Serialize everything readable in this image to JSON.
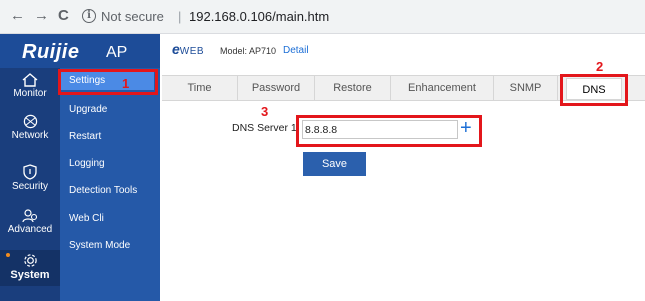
{
  "browser": {
    "back_glyph": "←",
    "forward_glyph": "→",
    "reload_glyph": "C",
    "info_glyph": "i",
    "secure_text": "Not secure",
    "separator": "|",
    "url": "192.168.0.106/main.htm"
  },
  "brand": {
    "logo": "Ruijie",
    "product": "AP"
  },
  "header": {
    "eweb_e": "e",
    "eweb_text": "WEB",
    "model": "Model: AP710",
    "detail_link": "Detail"
  },
  "sidebar": {
    "categories": [
      {
        "label": "Monitor",
        "icon": "home-icon"
      },
      {
        "label": "Network",
        "icon": "globe-icon"
      },
      {
        "label": "Security",
        "icon": "shield-icon"
      },
      {
        "label": "Advanced",
        "icon": "users-icon"
      },
      {
        "label": "System",
        "icon": "gear-icon",
        "selected": true
      }
    ],
    "subitems": [
      {
        "label": "Settings",
        "selected": true
      },
      {
        "label": "Upgrade"
      },
      {
        "label": "Restart"
      },
      {
        "label": "Logging"
      },
      {
        "label": "Detection Tools"
      },
      {
        "label": "Web Cli"
      },
      {
        "label": "System Mode"
      }
    ]
  },
  "tabs": [
    {
      "label": "Time"
    },
    {
      "label": "Password"
    },
    {
      "label": "Restore"
    },
    {
      "label": "Enhancement"
    },
    {
      "label": "SNMP"
    },
    {
      "label": "DNS",
      "active": true
    }
  ],
  "dns": {
    "label": "DNS Server 1",
    "value": "8.8.8.8",
    "add_glyph": "+",
    "save_label": "Save"
  },
  "annotations": {
    "step1": "1",
    "step2": "2",
    "step3": "3"
  },
  "colors": {
    "accent": "#2559a8",
    "highlight": "#e3161b",
    "link": "#1d6fd6"
  }
}
